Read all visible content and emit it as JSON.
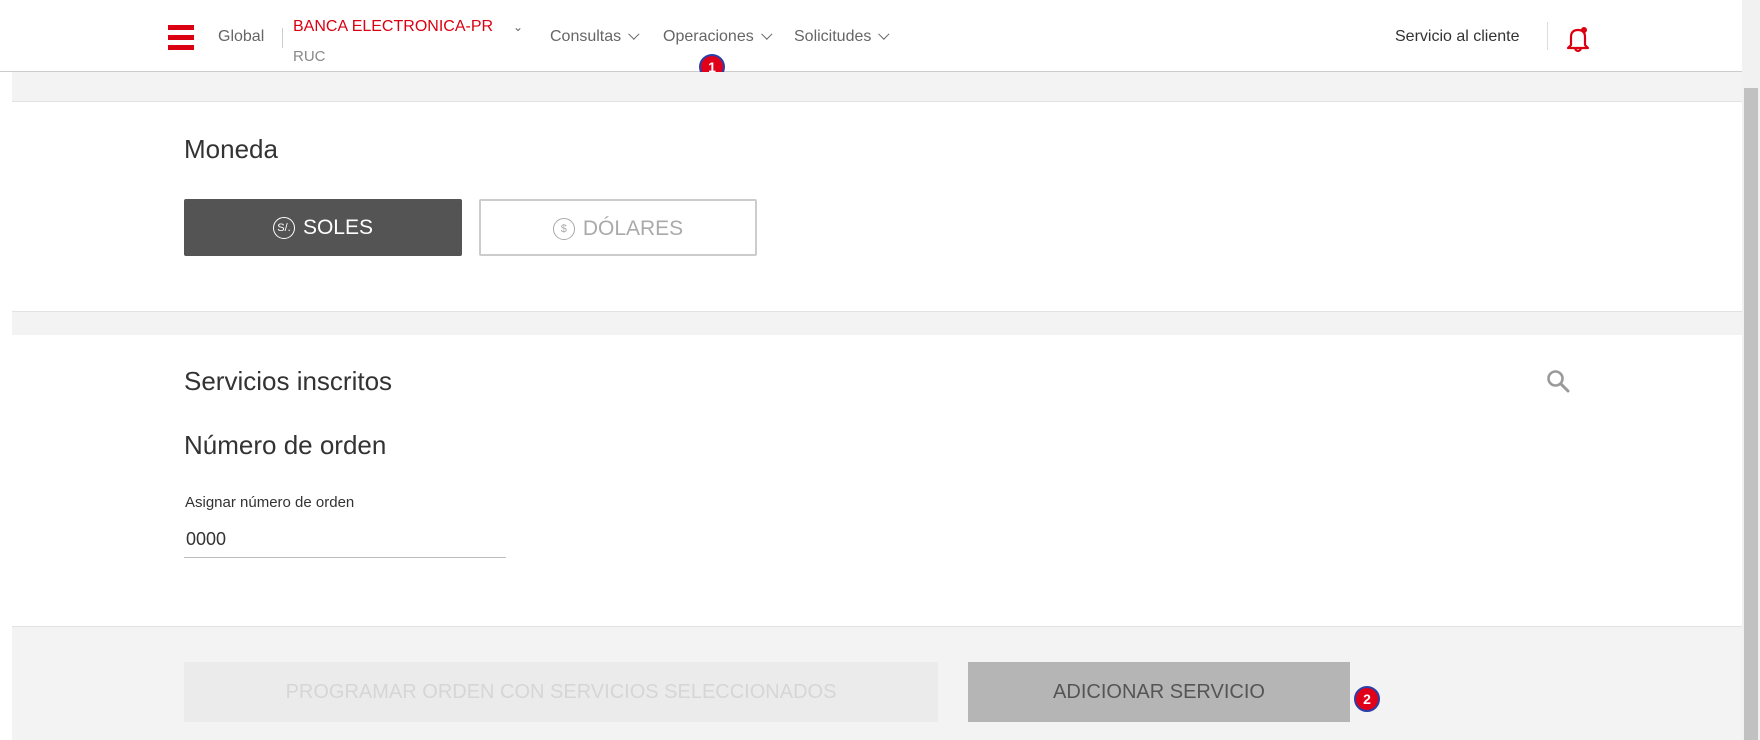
{
  "header": {
    "global_label": "Global",
    "bank_name": "BANCA ELECTRONICA-PR",
    "bank_sub": "RUC",
    "nav": {
      "consultas": "Consultas",
      "operaciones": "Operaciones",
      "solicitudes": "Solicitudes"
    },
    "service_link": "Servicio al cliente",
    "icons": [
      "hamburger-menu-icon",
      "bell-icon"
    ]
  },
  "badges": {
    "one": "1",
    "two": "2"
  },
  "currency": {
    "title": "Moneda",
    "soles_label": "SOLES",
    "soles_symbol": "S/.",
    "dolares_label": "DÓLARES",
    "dolares_symbol": "$",
    "selected": "SOLES"
  },
  "services": {
    "title": "Servicios inscritos",
    "order_title": "Número de orden",
    "order_field_label": "Asignar número de orden",
    "order_field_value": "0000"
  },
  "footer": {
    "programar_label": "PROGRAMAR ORDEN CON SERVICIOS SELECCIONADOS",
    "adicionar_label": "ADICIONAR SERVICIO"
  },
  "colors": {
    "brand_red": "#db0011",
    "selected_button": "#545454",
    "badge_border": "#2b3fa8"
  }
}
